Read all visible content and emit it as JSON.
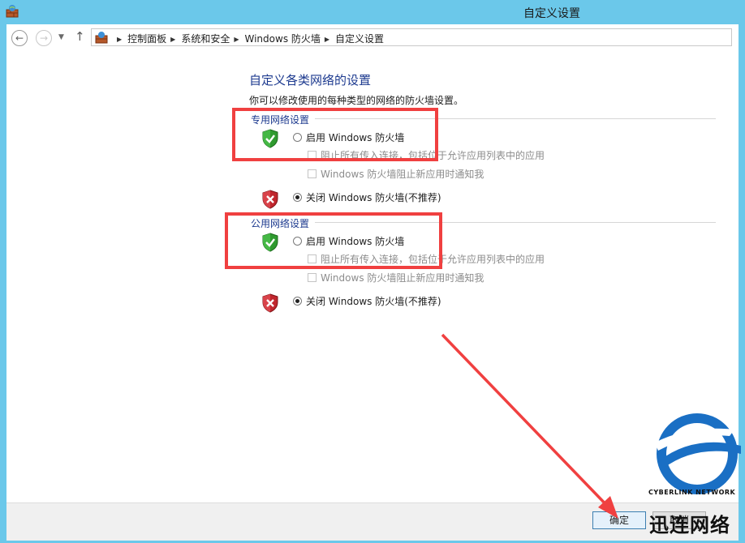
{
  "window": {
    "title": "自定义设置"
  },
  "nav": {
    "breadcrumbs": [
      "控制面板",
      "系统和安全",
      "Windows 防火墙",
      "自定义设置"
    ]
  },
  "main": {
    "heading": "自定义各类网络的设置",
    "subtitle": "你可以修改使用的每种类型的网络的防火墙设置。",
    "groups": [
      {
        "title": "专用网络设置",
        "enable_label": "启用 Windows 防火墙",
        "enable_selected": false,
        "block_all_label": "阻止所有传入连接，包括位于允许应用列表中的应用",
        "notify_label": "Windows 防火墙阻止新应用时通知我",
        "disable_label": "关闭 Windows 防火墙(不推荐)",
        "disable_selected": true
      },
      {
        "title": "公用网络设置",
        "enable_label": "启用 Windows 防火墙",
        "enable_selected": false,
        "block_all_label": "阻止所有传入连接，包括位于允许应用列表中的应用",
        "notify_label": "Windows 防火墙阻止新应用时通知我",
        "disable_label": "关闭 Windows 防火墙(不推荐)",
        "disable_selected": true
      }
    ]
  },
  "footer": {
    "ok_label": "确定",
    "cancel_label": "取消"
  },
  "watermark": {
    "brand": "迅连网络",
    "sub": "CYBERLINK NETWORK"
  },
  "colors": {
    "titlebar": "#6bc8ea",
    "heading": "#1d3a8f",
    "annotation_red": "#f04040",
    "watermark_blue": "#1a6fc4"
  },
  "icons": {
    "app": "firewall-app-icon",
    "back": "back-arrow-icon",
    "forward": "forward-arrow-icon",
    "up": "up-arrow-icon",
    "shield_on": "green-shield-check-icon",
    "shield_off": "red-shield-x-icon"
  }
}
